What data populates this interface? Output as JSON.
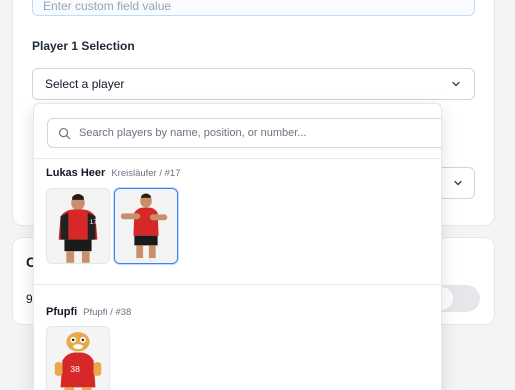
{
  "form": {
    "custom_field_placeholder": "Enter custom field value",
    "player1_label": "Player 1 Selection",
    "player_select_value": "Select a player"
  },
  "dropdown": {
    "search_placeholder": "Search players by name, position, or number...",
    "groups": [
      {
        "name": "Lukas Heer",
        "meta": "Kreisläufer / #17"
      },
      {
        "name": "Pfupfi",
        "meta": "Pfupfi / #38"
      }
    ]
  },
  "background_card": {
    "heading_partial": "C",
    "value_partial": "9"
  },
  "colors": {
    "accent": "#3b82f6",
    "jersey_red": "#d62828"
  },
  "icons": [
    "search-icon",
    "chevron-down-icon"
  ]
}
